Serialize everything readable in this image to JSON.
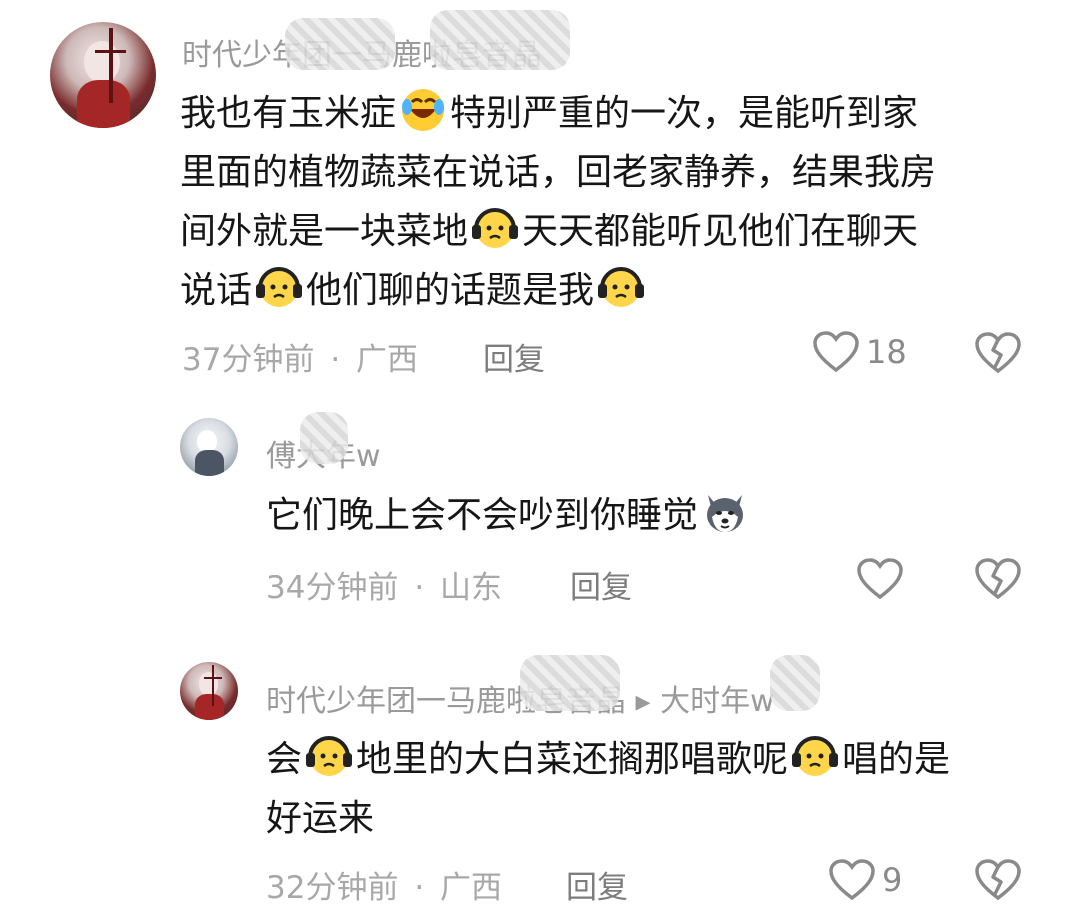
{
  "comments": [
    {
      "username": "时代少年团一马鹿啦皂音晶",
      "text_parts": [
        "我也有玉米症",
        "特别严重的一次，是能听到家",
        "里面的植物蔬菜在说话，回老家静养，结果我房",
        "间外就是一块菜地",
        "天天都能听见他们在聊天",
        "说话",
        "他们聊的话题是我"
      ],
      "time": "37分钟前",
      "separator": "·",
      "location": "广西",
      "reply_label": "回复",
      "likes": "18"
    },
    {
      "username": "傅大年w",
      "text_parts": [
        "它们晚上会不会吵到你睡觉"
      ],
      "time": "34分钟前",
      "separator": "·",
      "location": "山东",
      "reply_label": "回复",
      "likes": ""
    },
    {
      "username": "时代少年团一马鹿啦皂音晶 ▸ 大时年w",
      "text_parts": [
        "会",
        "地里的大白菜还搁那唱歌呢",
        "唱的是",
        "好运来"
      ],
      "time": "32分钟前",
      "separator": "·",
      "location": "广西",
      "reply_label": "回复",
      "likes": "9"
    }
  ],
  "icons": {
    "like": "heart-outline-icon",
    "dislike": "broken-heart-icon",
    "emoji_laugh": "rolling-laughing-emoji",
    "emoji_headphones": "headphones-frown-emoji",
    "emoji_dog": "husky-dog-emoji"
  },
  "colors": {
    "text": "#161616",
    "meta": "#a8a8a8",
    "icon": "#8a8a8a"
  }
}
